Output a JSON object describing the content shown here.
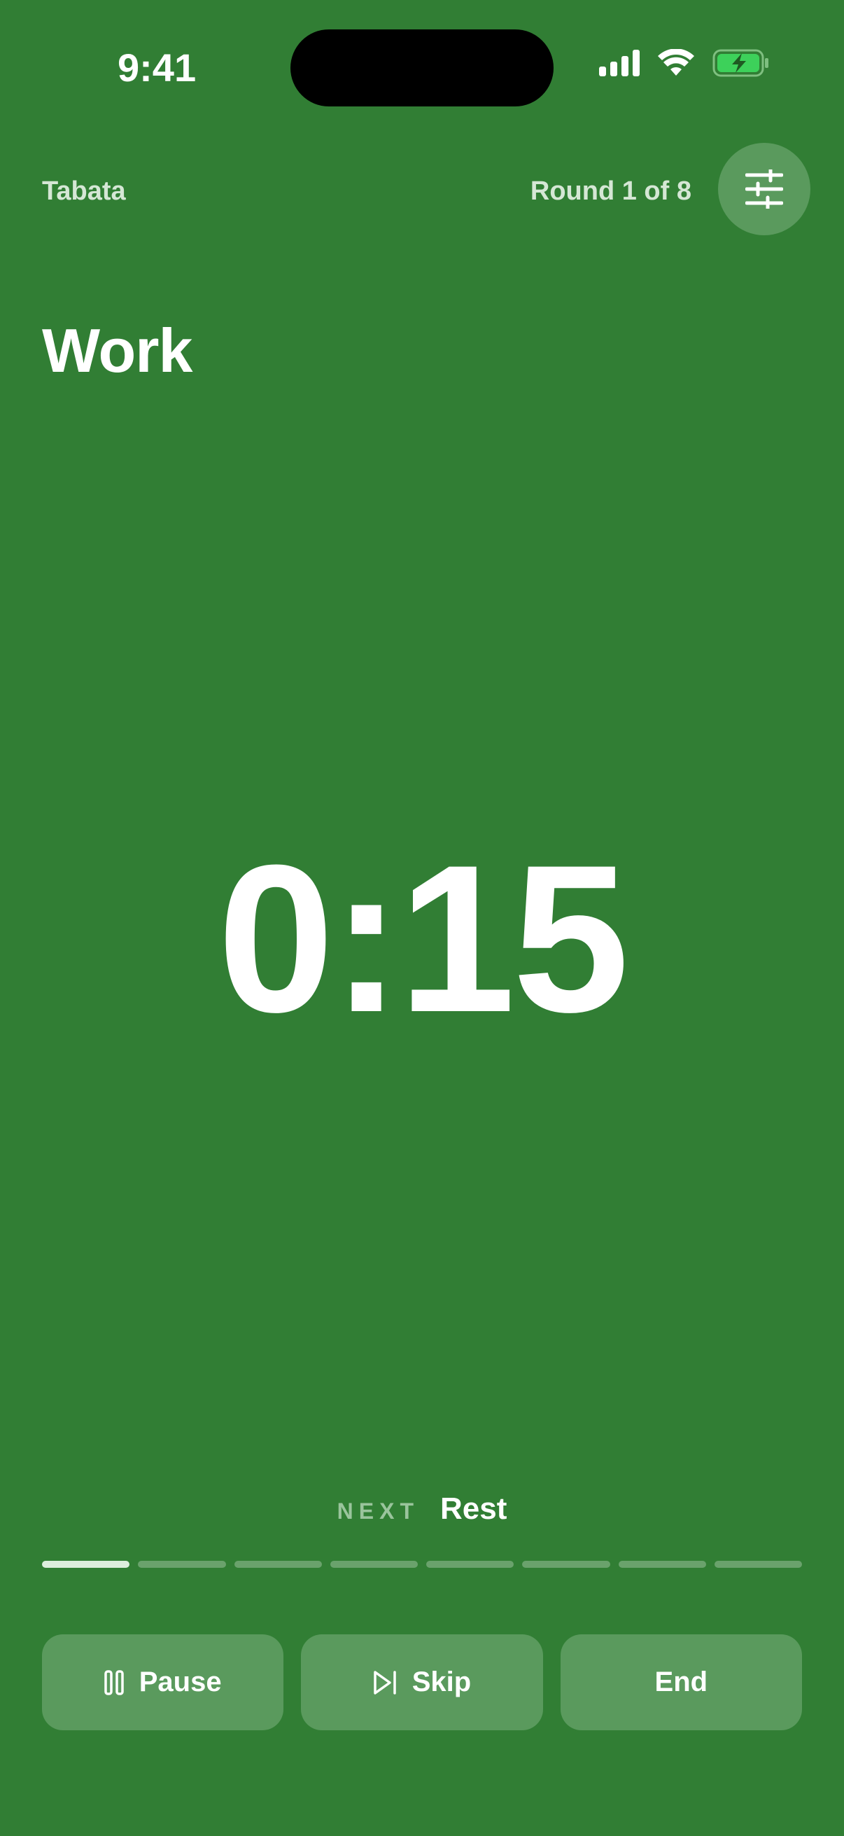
{
  "status_bar": {
    "time": "9:41",
    "icons": [
      "cellular-signal-icon",
      "wifi-icon",
      "battery-charging-icon"
    ]
  },
  "header": {
    "workout_name": "Tabata",
    "round_label": "Round 1 of 8",
    "settings_icon": "sliders-icon"
  },
  "phase": {
    "title": "Work",
    "timer": "0:15"
  },
  "next": {
    "label": "NEXT",
    "value": "Rest"
  },
  "progress": {
    "total_rounds": 8,
    "current_round": 1
  },
  "controls": {
    "pause_label": "Pause",
    "pause_icon": "pause-icon",
    "skip_label": "Skip",
    "skip_icon": "skip-forward-icon",
    "end_label": "End"
  },
  "colors": {
    "background": "#317E34",
    "button": "#5A9A5D",
    "progress_inactive": "#6AA26C",
    "progress_active": "#DDEEDD",
    "battery_fill": "#3DD15A"
  }
}
